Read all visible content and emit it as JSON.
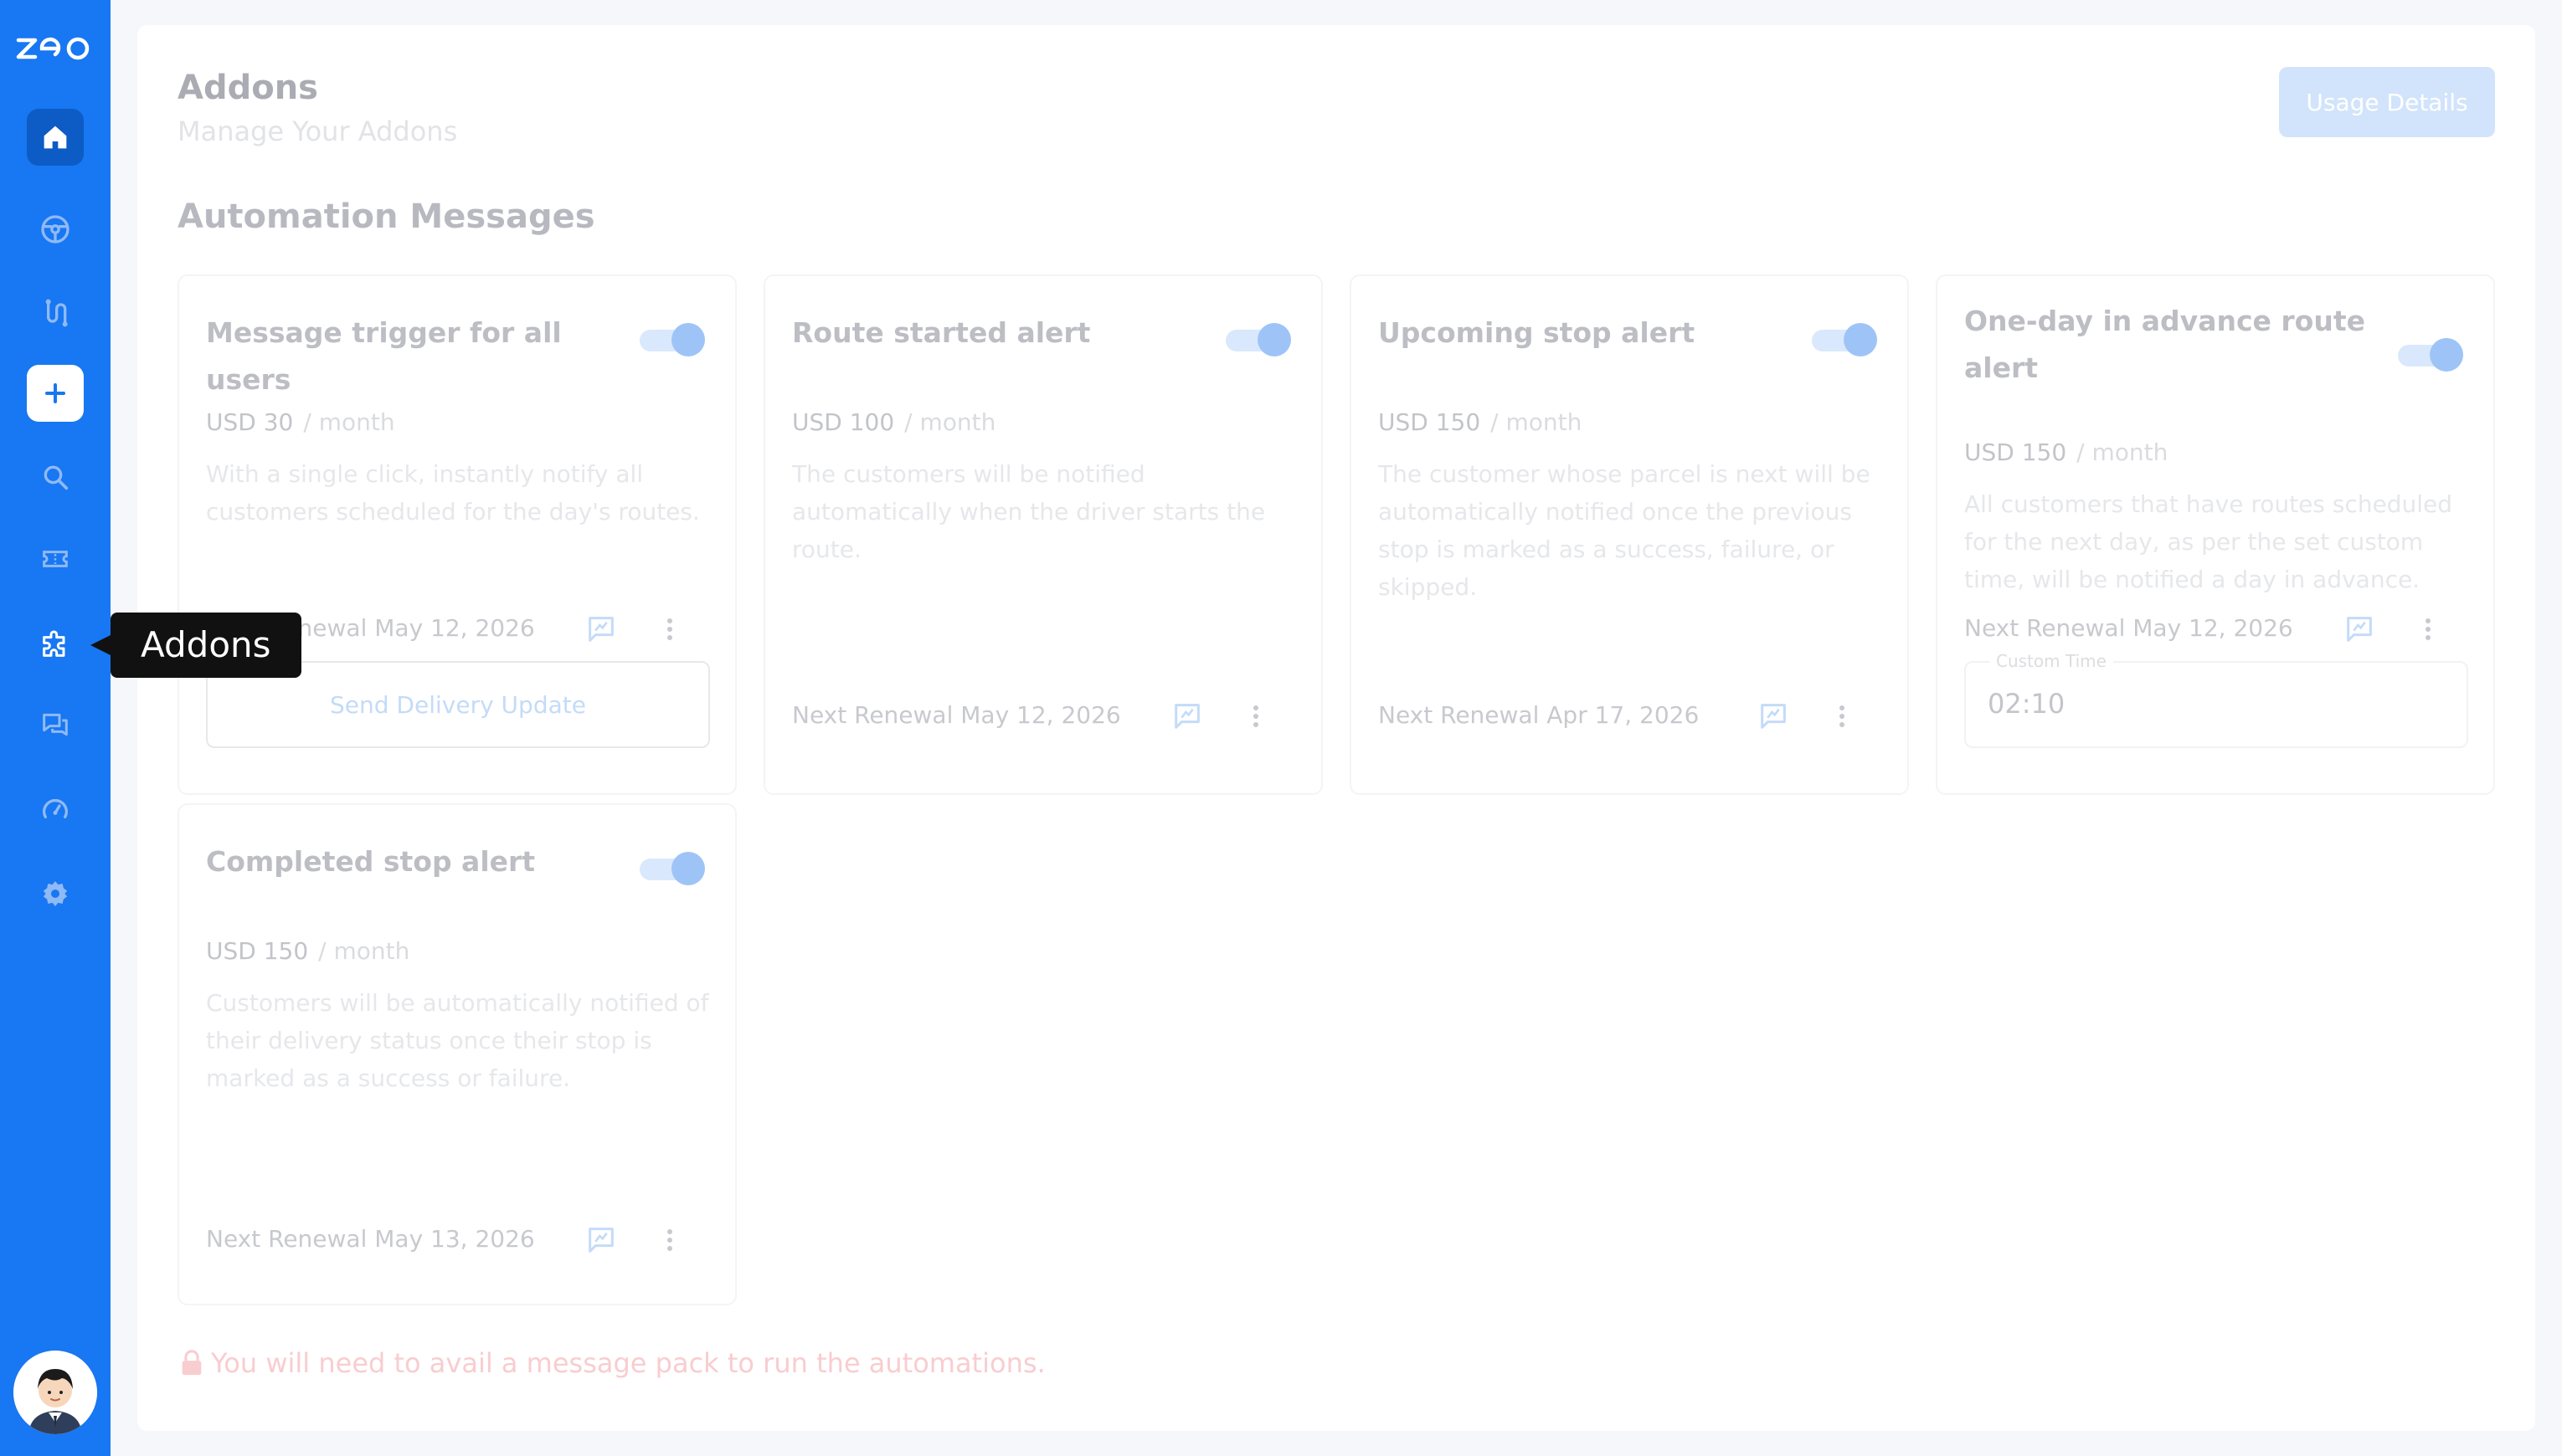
{
  "sidebar": {
    "logo": "zeo",
    "items": [
      {
        "name": "home",
        "icon": "home-icon",
        "active": true
      },
      {
        "name": "drivers",
        "icon": "steering-wheel-icon"
      },
      {
        "name": "routes",
        "icon": "route-icon"
      },
      {
        "name": "create",
        "icon": "plus-icon"
      },
      {
        "name": "search",
        "icon": "search-icon"
      },
      {
        "name": "tickets",
        "icon": "ticket-icon"
      },
      {
        "name": "addons",
        "icon": "puzzle-icon"
      },
      {
        "name": "messages",
        "icon": "chat-icon"
      },
      {
        "name": "dashboard",
        "icon": "speedometer-icon"
      },
      {
        "name": "settings",
        "icon": "gear-icon"
      }
    ],
    "tooltip": "Addons"
  },
  "header": {
    "title": "Addons",
    "subtitle": "Manage Your Addons",
    "usage_button": "Usage Details"
  },
  "section_title": "Automation Messages",
  "cards": [
    {
      "title": "Message trigger for all users",
      "price": "USD 30",
      "period": "/ month",
      "description": "With a single click, instantly notify all customers scheduled for the day's routes.",
      "renewal": "Next Renewal May 12, 2026",
      "enabled": true,
      "action_button": "Send Delivery Update"
    },
    {
      "title": "Route started alert",
      "price": "USD 100",
      "period": "/ month",
      "description": "The customers will be notified automatically when the driver starts the route.",
      "renewal": "Next Renewal May 12, 2026",
      "enabled": true
    },
    {
      "title": "Upcoming stop alert",
      "price": "USD 150",
      "period": "/ month",
      "description": "The customer whose parcel is next will be automatically notified once the previous stop is marked as a success, failure, or skipped.",
      "renewal": "Next Renewal Apr 17, 2026",
      "enabled": true
    },
    {
      "title": "One-day in advance route alert",
      "price": "USD 150",
      "period": "/ month",
      "description": "All customers that have routes scheduled for the next day, as per the set custom time, will be notified a day in advance.",
      "renewal": "Next Renewal May 12, 2026",
      "enabled": true,
      "custom_time_label": "Custom Time",
      "custom_time_value": "02:10"
    },
    {
      "title": "Completed stop alert",
      "price": "USD 150",
      "period": "/ month",
      "description": "Customers will be automatically notified of their delivery status once their stop is marked as a success or failure.",
      "renewal": "Next Renewal May 13, 2026",
      "enabled": true
    }
  ],
  "notice": "You will need to avail a message pack to run the automations.",
  "colors": {
    "sidebar": "#1877f2",
    "accent": "#1877f2",
    "notice": "#f8cdd0"
  }
}
